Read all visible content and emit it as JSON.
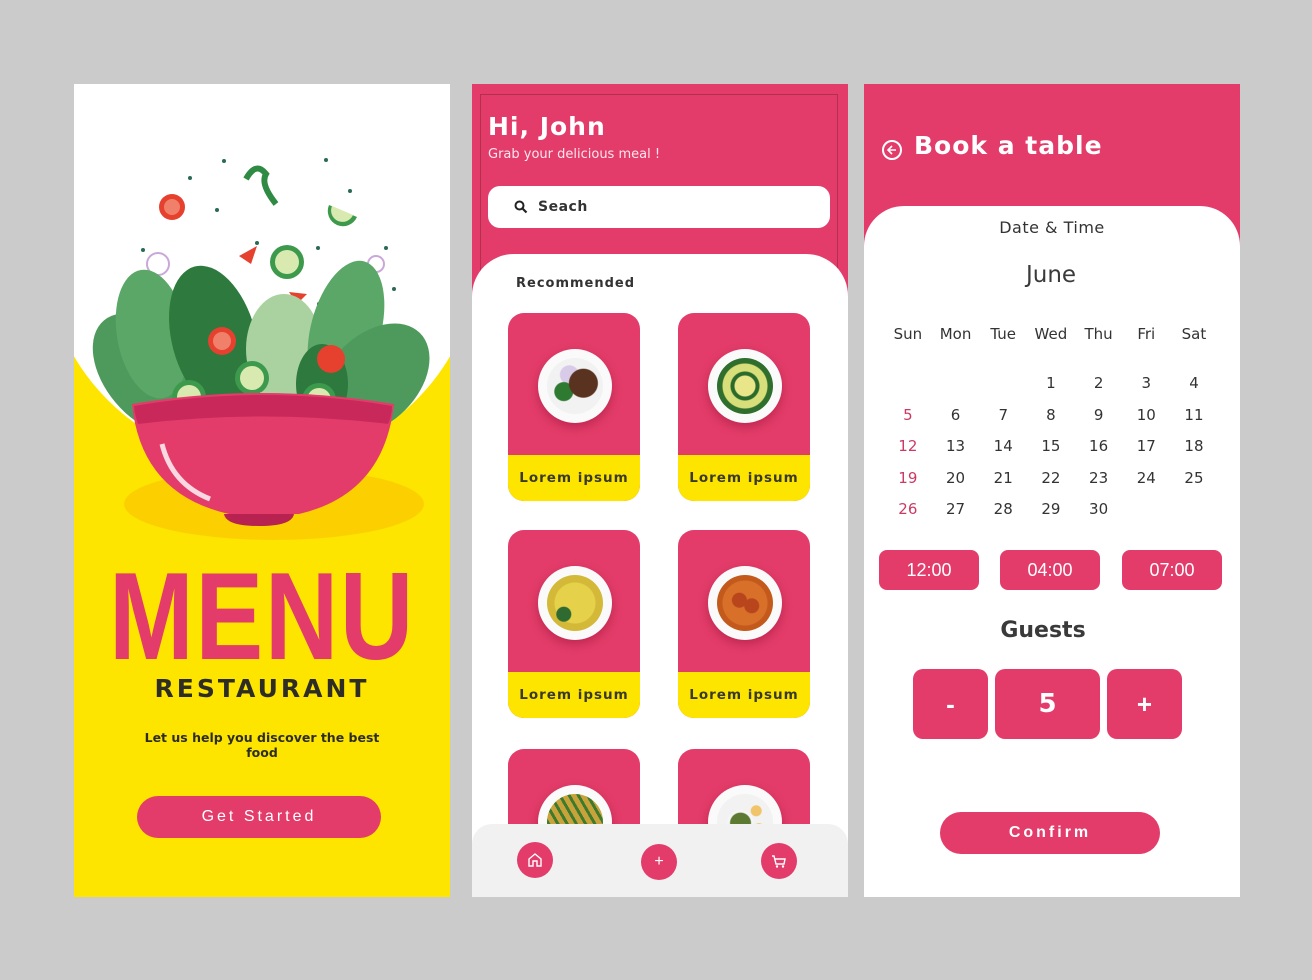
{
  "colors": {
    "accent": "#e33c6a",
    "yellow": "#fde500",
    "text_dark": "#333333",
    "background": "#cbcbcb"
  },
  "welcome": {
    "title": "MENU",
    "subtitle": "RESTAURANT",
    "tagline": "Let us help you discover the best food",
    "cta_label": "Get Started",
    "illustration": "salad-bowl"
  },
  "home": {
    "greeting": "Hi, John",
    "greeting_sub": "Grab your delicious meal !",
    "search": {
      "icon": "search-icon",
      "placeholder": "Seach"
    },
    "section_title": "Recommended",
    "items": [
      {
        "label": "Lorem ipsum",
        "dish": "kebab-plate"
      },
      {
        "label": "Lorem ipsum",
        "dish": "curry-bowl"
      },
      {
        "label": "Lorem ipsum",
        "dish": "rice-plate"
      },
      {
        "label": "Lorem ipsum",
        "dish": "dumpling-curry"
      },
      {
        "label": "",
        "dish": "bean-curry"
      },
      {
        "label": "",
        "dish": "snack-platter"
      }
    ],
    "nav": [
      {
        "icon": "home-icon"
      },
      {
        "icon": "plus-icon",
        "glyph": "+"
      },
      {
        "icon": "cart-icon"
      }
    ]
  },
  "booking": {
    "title": "Book a table",
    "back_icon": "back-arrow-icon",
    "section": "Date & Time",
    "month": "June",
    "weekdays": [
      "Sun",
      "Mon",
      "Tue",
      "Wed",
      "Thu",
      "Fri",
      "Sat"
    ],
    "weeks": [
      [
        "",
        "",
        "",
        "1",
        "2",
        "3",
        "4"
      ],
      [
        "5",
        "6",
        "7",
        "8",
        "9",
        "10",
        "11"
      ],
      [
        "12",
        "13",
        "14",
        "15",
        "16",
        "17",
        "18"
      ],
      [
        "19",
        "20",
        "21",
        "22",
        "23",
        "24",
        "25"
      ],
      [
        "26",
        "27",
        "28",
        "29",
        "30",
        "",
        ""
      ]
    ],
    "time_slots": [
      "12:00",
      "04:00",
      "07:00"
    ],
    "guests_label": "Guests",
    "guests_minus": "-",
    "guests_value": "5",
    "guests_plus": "+",
    "confirm_label": "Confirm"
  }
}
